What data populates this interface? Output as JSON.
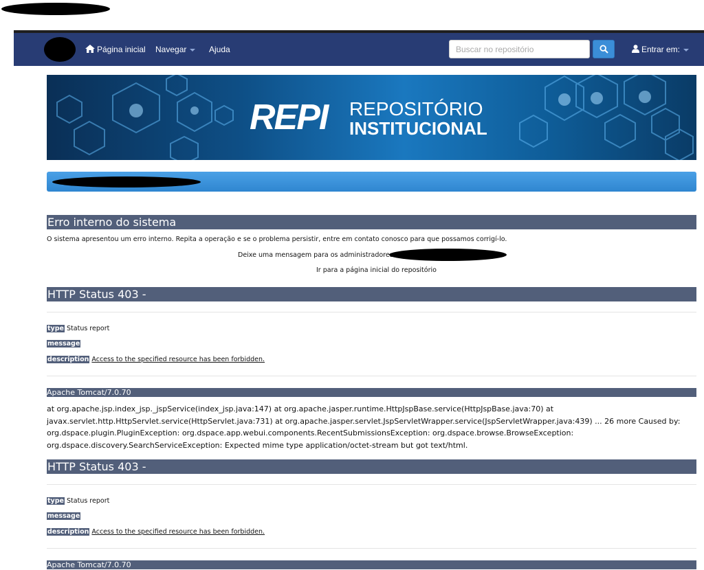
{
  "navbar": {
    "home_label": "Página inicial",
    "browse_label": "Navegar",
    "help_label": "Ajuda",
    "search_placeholder": "Buscar no repositório",
    "login_label": "Entrar em:"
  },
  "banner": {
    "logo_text": "REPI",
    "title_line1": "REPOSITÓRIO",
    "title_line2": "INSTITUCIONAL"
  },
  "error": {
    "title": "Erro interno do sistema",
    "message": "O sistema apresentou um erro interno. Repita a operação e se o problema persistir, entre em contato conosco para que possamos corrigí-lo.",
    "contact_text": "Deixe uma mensagem para os administradores do",
    "home_link": "Ir para a página inicial do repositório"
  },
  "status_blocks": [
    {
      "title": "HTTP Status 403 -",
      "type_label": "type",
      "type_value": "Status report",
      "message_label": "message",
      "description_label": "description",
      "description_value": "Access to the specified resource has been forbidden.",
      "server": "Apache Tomcat/7.0.70"
    },
    {
      "title": "HTTP Status 403 -",
      "type_label": "type",
      "type_value": "Status report",
      "message_label": "message",
      "description_label": "description",
      "description_value": "Access to the specified resource has been forbidden.",
      "server": "Apache Tomcat/7.0.70"
    }
  ],
  "stack_trace": "at org.apache.jsp.index_jsp._jspService(index_jsp.java:147) at org.apache.jasper.runtime.HttpJspBase.service(HttpJspBase.java:70) at javax.servlet.http.HttpServlet.service(HttpServlet.java:731) at org.apache.jasper.servlet.JspServletWrapper.service(JspServletWrapper.java:439) ... 26 more Caused by: org.dspace.plugin.PluginException: org.dspace.app.webui.components.RecentSubmissionsException: org.dspace.browse.BrowseException: org.dspace.discovery.SearchServiceException: Expected mime type application/octet-stream but got text/html.",
  "icons": {
    "home": "home-icon",
    "search": "search-icon",
    "user": "user-icon",
    "caret": "chevron-down-icon"
  },
  "colors": {
    "navbar": "#283c74",
    "heading_bar": "#525f7a",
    "search_button": "#3b8ed8",
    "blue_bar": "#3a90d8"
  }
}
